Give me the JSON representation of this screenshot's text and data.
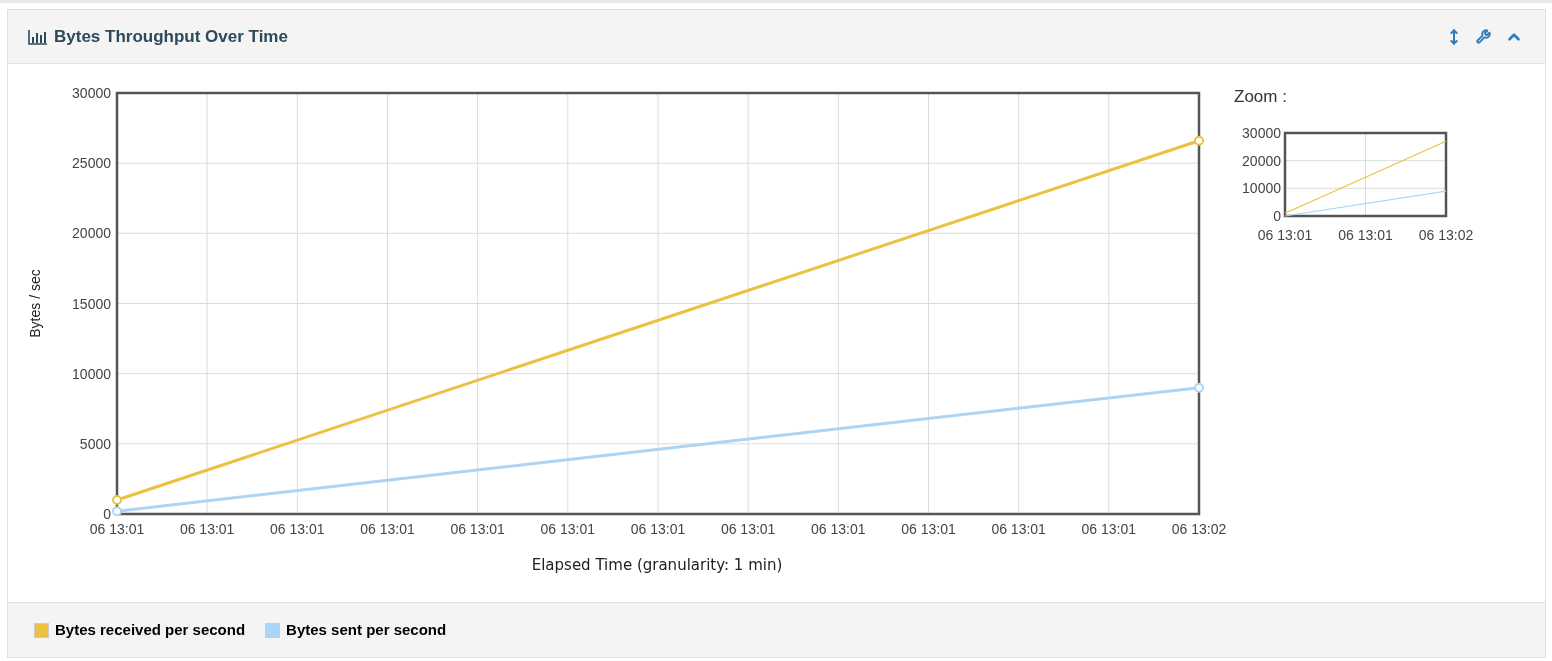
{
  "panel": {
    "title": "Bytes Throughput Over Time",
    "zoom_label": "Zoom :"
  },
  "chart": {
    "chart_data": {
      "type": "line",
      "grid": true,
      "xlabel": "Elapsed Time (granularity: 1 min)",
      "ylabel": "Bytes / sec",
      "ylim": [
        0,
        30000
      ],
      "categories": [
        "06 13:01",
        "06 13:01",
        "06 13:01",
        "06 13:01",
        "06 13:01",
        "06 13:01",
        "06 13:01",
        "06 13:01",
        "06 13:01",
        "06 13:01",
        "06 13:01",
        "06 13:01",
        "06 13:02"
      ],
      "yticks": [
        0,
        5000,
        10000,
        15000,
        20000,
        25000,
        30000
      ],
      "series": [
        {
          "name": "Bytes received per second",
          "color": "#ecc040",
          "marker": true,
          "values": [
            1000,
            null,
            null,
            null,
            null,
            null,
            null,
            null,
            null,
            null,
            null,
            null,
            26600
          ]
        },
        {
          "name": "Bytes sent per second",
          "color": "#acd4f4",
          "marker": true,
          "values": [
            200,
            null,
            null,
            null,
            null,
            null,
            null,
            null,
            null,
            null,
            null,
            null,
            9000
          ]
        }
      ]
    }
  },
  "zoom_chart": {
    "chart_data": {
      "type": "line",
      "grid": true,
      "ylim": [
        0,
        30000
      ],
      "categories": [
        "06 13:01",
        "06 13:01",
        "06 13:02"
      ],
      "yticks": [
        0,
        10000,
        20000,
        30000
      ],
      "series": [
        {
          "color": "#ecc040",
          "values": [
            1000,
            null,
            27000
          ]
        },
        {
          "color": "#acd4f4",
          "values": [
            0,
            null,
            9000
          ]
        }
      ]
    }
  }
}
